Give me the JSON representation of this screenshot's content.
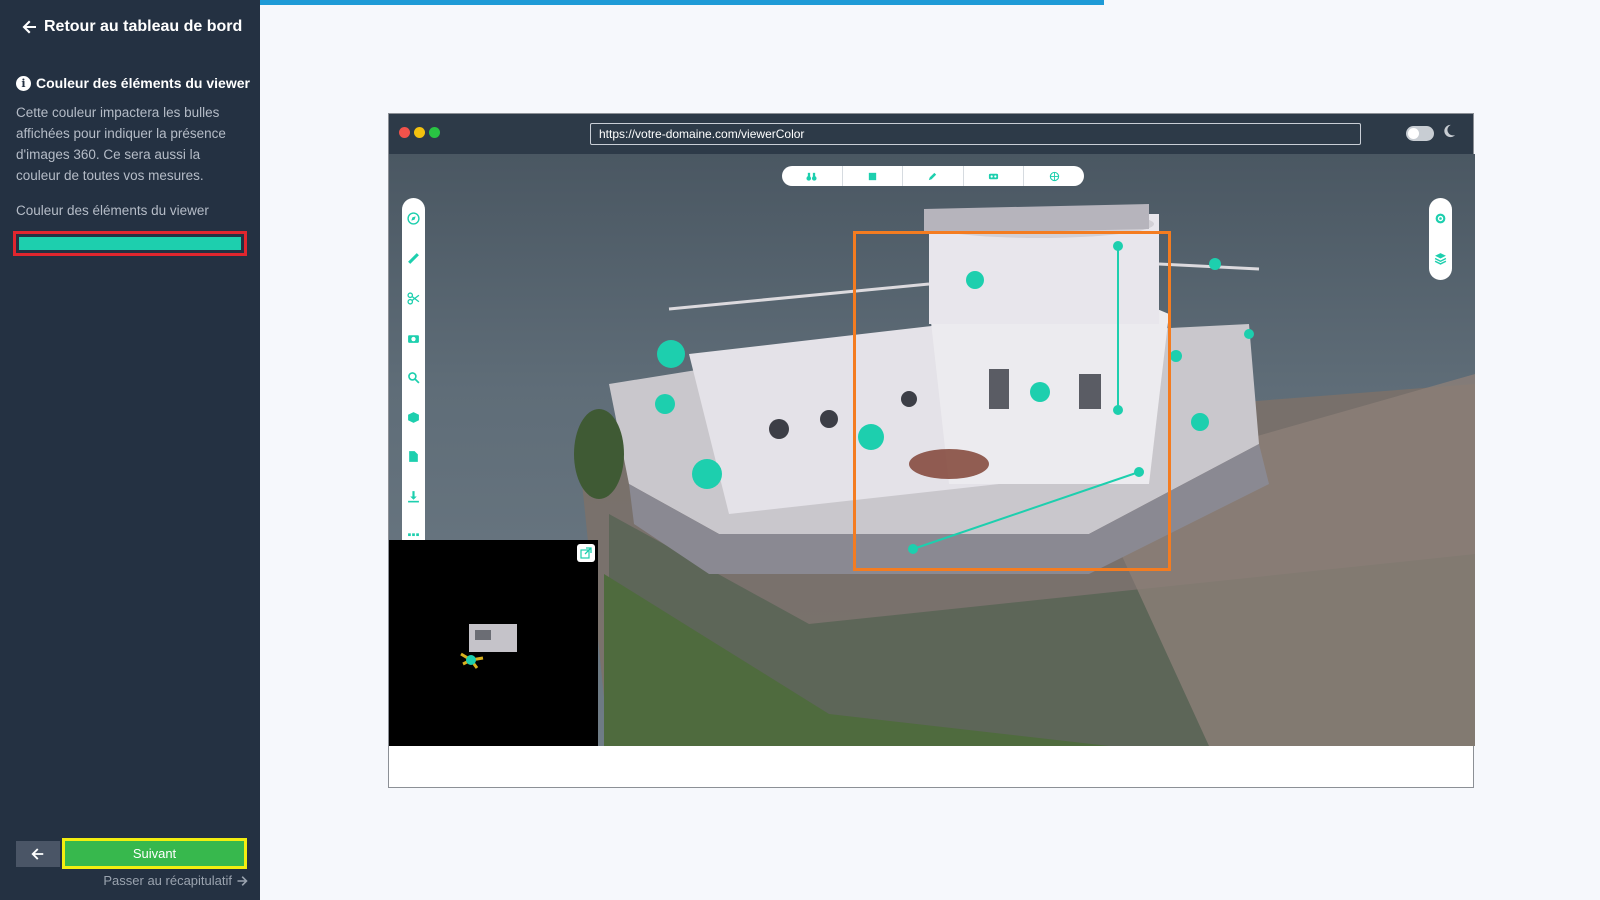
{
  "sidebar": {
    "back_label": "Retour au tableau de bord",
    "section_title": "Couleur des éléments du viewer",
    "section_description": "Cette couleur impactera les bulles affichées pour indiquer la présence d'images 360. Ce sera aussi la couleur de toutes vos mesures.",
    "field_label": "Couleur des éléments du viewer",
    "selected_color": "#1dcfae",
    "next_label": "Suivant",
    "skip_label": "Passer au récapitulatif"
  },
  "progress": {
    "fraction": 0.63,
    "color": "#1e9bd7"
  },
  "browser": {
    "url": "https://votre-domaine.com/viewerColor"
  },
  "viewer": {
    "accent_color": "#1dcfae",
    "top_tools": [
      "binoculars-icon",
      "square-icon",
      "pencil-icon",
      "vr-headset-icon",
      "globe-icon"
    ],
    "left_tools": [
      "compass-icon",
      "ruler-icon",
      "scissors-icon",
      "camera-icon",
      "search-icon",
      "cube-icon",
      "file-icon",
      "download-icon",
      "grid-icon"
    ],
    "right_tools": [
      "settings-icon",
      "layers-icon"
    ]
  }
}
